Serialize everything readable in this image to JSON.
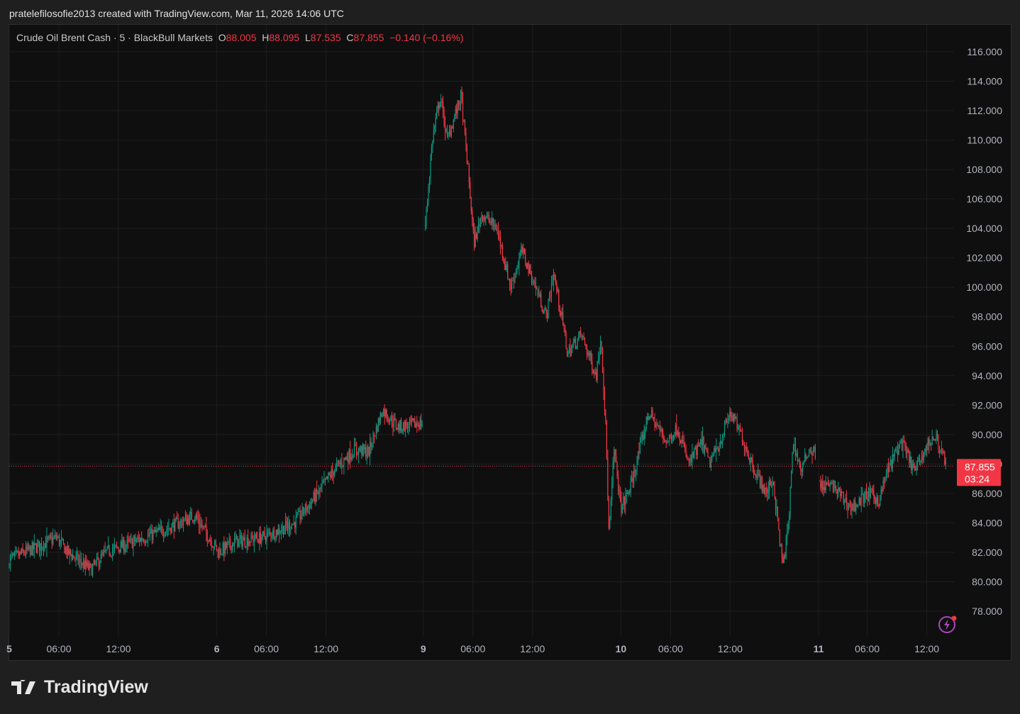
{
  "credit": "pratelefilosofie2013 created with TradingView.com, Mar 11, 2026 14:06 UTC",
  "legend": {
    "symbol": "Crude Oil Brent Cash · 5 · BlackBull Markets",
    "o_label": "O",
    "o": "88.005",
    "h_label": "H",
    "h": "88.095",
    "l_label": "L",
    "l": "87.535",
    "c_label": "C",
    "c": "87.855",
    "change": "−0.140 (−0.16%)"
  },
  "price_label": {
    "price": "87.855",
    "countdown": "03:24"
  },
  "logo": "TradingView",
  "colors": {
    "up": "#089981",
    "down": "#f23645",
    "bg": "#0f0f0f",
    "grid": "#1e1e1e"
  },
  "chart_data": {
    "type": "candlestick",
    "title": "Crude Oil Brent Cash · 5 · BlackBull Markets",
    "ylim": [
      76,
      117
    ],
    "y_ticks": [
      "116.000",
      "114.000",
      "112.000",
      "110.000",
      "108.000",
      "106.000",
      "104.000",
      "102.000",
      "100.000",
      "98.000",
      "96.000",
      "94.000",
      "92.000",
      "90.000",
      "88.000",
      "86.000",
      "84.000",
      "82.000",
      "80.000",
      "78.000"
    ],
    "x_ticks": [
      {
        "t": 0,
        "label": "5"
      },
      {
        "t": 5,
        "label": "06:00"
      },
      {
        "t": 11,
        "label": "12:00"
      },
      {
        "t": 20.9,
        "label": "6"
      },
      {
        "t": 25.9,
        "label": "06:00"
      },
      {
        "t": 31.9,
        "label": "12:00"
      },
      {
        "t": 41.7,
        "label": "9"
      },
      {
        "t": 46.7,
        "label": "06:00"
      },
      {
        "t": 52.7,
        "label": "12:00"
      },
      {
        "t": 61.6,
        "label": "10"
      },
      {
        "t": 66.6,
        "label": "06:00"
      },
      {
        "t": 72.6,
        "label": "12:00"
      },
      {
        "t": 81.5,
        "label": "11"
      },
      {
        "t": 86.4,
        "label": "06:00"
      },
      {
        "t": 92.4,
        "label": "12:00"
      }
    ],
    "current_price": 87.855,
    "segments": [
      [
        [
          0,
          81.5
        ],
        [
          4.8,
          83
        ],
        [
          5.9,
          82
        ],
        [
          8.2,
          80.8
        ],
        [
          9.8,
          82
        ],
        [
          15.5,
          83.5
        ],
        [
          18.7,
          84.5
        ],
        [
          21.1,
          82
        ],
        [
          22.6,
          82.7
        ],
        [
          25.5,
          83
        ],
        [
          28.7,
          84
        ],
        [
          30.5,
          85.5
        ],
        [
          32.6,
          87.5
        ],
        [
          34.8,
          89
        ],
        [
          36.2,
          88.8
        ],
        [
          37.6,
          91.7
        ],
        [
          39.1,
          90.5
        ],
        [
          41.6,
          90.8
        ]
      ],
      [
        [
          41.9,
          104.2
        ],
        [
          42.6,
          110
        ],
        [
          43.4,
          113
        ],
        [
          44.1,
          110
        ],
        [
          45.5,
          113
        ],
        [
          46.2,
          108
        ],
        [
          46.8,
          103
        ],
        [
          47.6,
          105
        ],
        [
          49.1,
          104
        ],
        [
          50.5,
          100
        ],
        [
          51.6,
          102.5
        ],
        [
          53,
          100
        ],
        [
          54.1,
          98
        ],
        [
          54.8,
          101
        ],
        [
          55.9,
          97
        ],
        [
          56.2,
          95.5
        ],
        [
          57.6,
          96.8
        ],
        [
          59.1,
          94
        ],
        [
          59.6,
          96.8
        ],
        [
          60.1,
          90
        ],
        [
          60.4,
          83
        ],
        [
          60.9,
          89
        ],
        [
          61.6,
          85
        ],
        [
          62.6,
          86.5
        ],
        [
          64.4,
          91.5
        ],
        [
          66.2,
          89.5
        ],
        [
          67.3,
          90.5
        ],
        [
          68.4,
          88
        ],
        [
          69.8,
          89.5
        ],
        [
          70.5,
          88
        ],
        [
          71.6,
          89.5
        ],
        [
          72.6,
          91.5
        ],
        [
          73.7,
          90
        ],
        [
          75.1,
          87.5
        ],
        [
          76.2,
          86
        ],
        [
          76.9,
          87
        ],
        [
          77.9,
          81
        ],
        [
          78.5,
          84
        ],
        [
          78.9,
          89.5
        ],
        [
          79.8,
          87.5
        ],
        [
          80.5,
          89
        ],
        [
          81.2,
          88.8
        ]
      ],
      [
        [
          81.6,
          86.5
        ],
        [
          83,
          86.5
        ],
        [
          84.8,
          85
        ],
        [
          86.6,
          86
        ],
        [
          87.6,
          85.5
        ],
        [
          88.4,
          87.5
        ],
        [
          89.8,
          89.5
        ],
        [
          91.2,
          87.5
        ],
        [
          92.6,
          89.5
        ],
        [
          93.3,
          89.8
        ],
        [
          94.4,
          87.9
        ]
      ]
    ]
  }
}
